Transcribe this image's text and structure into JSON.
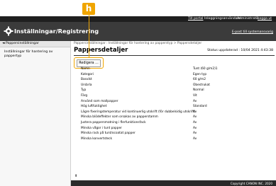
{
  "topbar": {
    "portal": "Till portal",
    "login_label": "Inloggningsanvändare :",
    "user": "Administratör",
    "logout": "Logga ut"
  },
  "header": {
    "title": "Inställningar/Registrering",
    "email_link": "E-post till systemansvarig"
  },
  "sidebar": {
    "top": "◄ Pappersinställningar",
    "items": [
      {
        "label": "Inställningar för hantering av pappertyp"
      }
    ]
  },
  "main": {
    "breadcrumb": "Pappersinställningar : Inställningar för hantering av papperstyp > Pappersdetaljer",
    "title": "Pappersdetaljer",
    "status": "Status uppdaterad : 10/04 2021 4:43:38",
    "edit_button": "Redigera ...",
    "rows": [
      {
        "k": "Namn",
        "v": "Tunt (60 g/m2)1"
      },
      {
        "k": "Kategori",
        "v": "Egen typ"
      },
      {
        "k": "Basvikt",
        "v": "60 g/m2"
      },
      {
        "k": "Ursbrla",
        "v": "Obestrukat"
      },
      {
        "k": "Typ",
        "v": "Normal"
      },
      {
        "k": "Färg",
        "v": "Vit"
      },
      {
        "k": "Använd som mallpapper",
        "v": "Av"
      },
      {
        "k": "Hög luftfuktighet",
        "v": "Standard"
      },
      {
        "k": "Lägre fixeringstemperatur vid kontinuerlig utskrift (för dubbelsidig utskrift)",
        "v": "Av"
      },
      {
        "k": "Minska blödeffekter som orsakas av papperstamm",
        "v": "Av"
      },
      {
        "k": "Justera pappersmatning i flerfunktionsfack",
        "v": "Av"
      },
      {
        "k": "Minska vågor i tunt papper",
        "v": "Av"
      },
      {
        "k": "Minska rack på tunt/ocoatat papper",
        "v": "Av"
      },
      {
        "k": "Minska konvertsteck",
        "v": "Av"
      }
    ]
  },
  "footer": {
    "copyright": "Copyright CANON INC. 2020"
  },
  "callout": {
    "label": "h"
  },
  "colors": {
    "callout": "#f0a500",
    "header": "#3b3b3b",
    "topbar": "#1f1f1f"
  }
}
